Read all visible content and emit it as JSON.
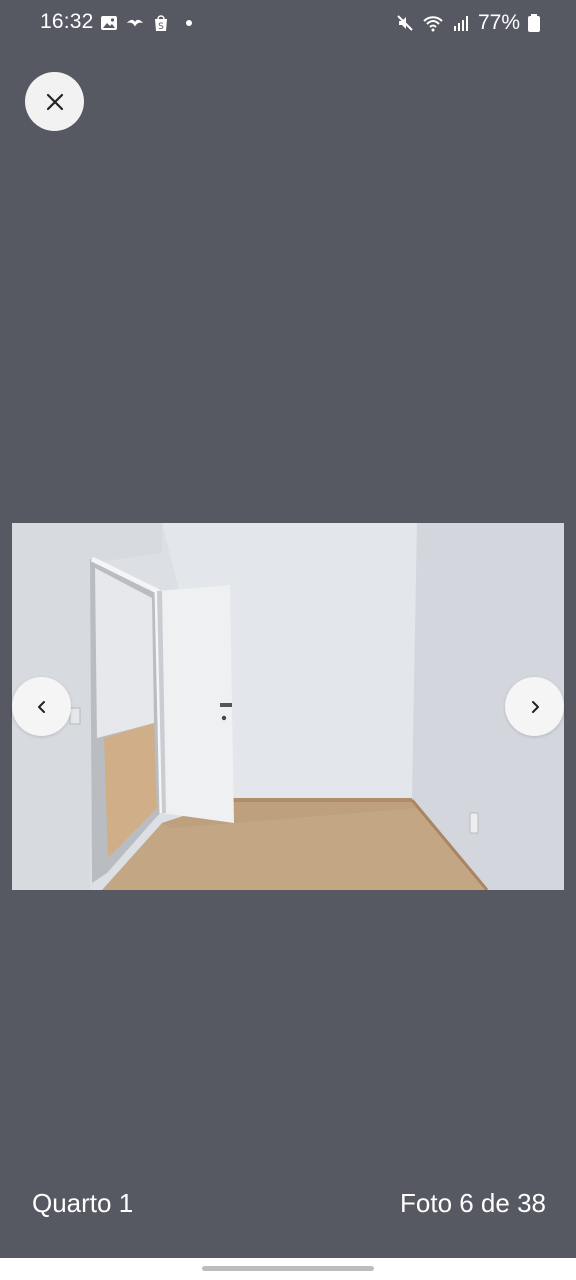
{
  "status_bar": {
    "time": "16:32",
    "battery": "77%",
    "left_icons": [
      "gallery-icon",
      "bird-app-icon",
      "shopee-icon",
      "notification-dot-icon"
    ],
    "right_icons": [
      "mute-icon",
      "wifi-icon",
      "signal-icon",
      "battery-icon"
    ]
  },
  "viewer": {
    "close_icon": "close-icon",
    "prev_icon": "chevron-left-icon",
    "next_icon": "chevron-right-icon",
    "caption": "Quarto 1",
    "counter": "Foto 6 de 38"
  },
  "colors": {
    "background": "#565862",
    "button": "#f2f2f2",
    "text": "#ffffff"
  }
}
